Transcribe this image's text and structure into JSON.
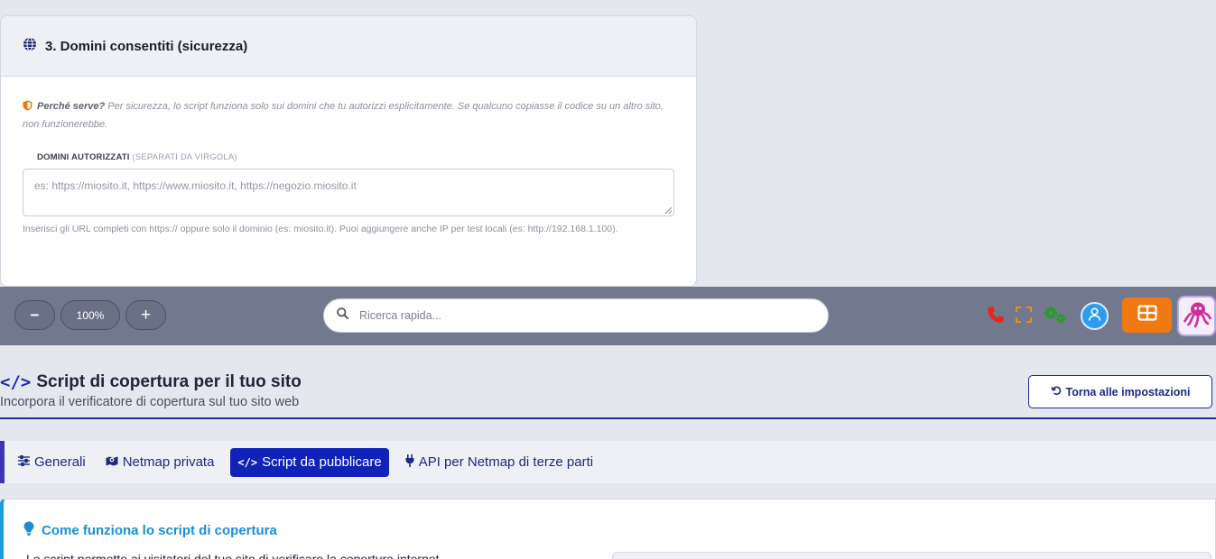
{
  "domains_card": {
    "title": "3. Domini consentiti (sicurezza)",
    "why_label": "Perché serve?",
    "why_text": " Per sicurezza, lo script funziona solo sui domini che tu autorizzi esplicitamente. Se qualcuno copiasse il codice su un altro sito, non funzionerebbe.",
    "field_label": "DOMINI AUTORIZZATI",
    "field_label_sub": "(SEPARATI DA VIRGOLA)",
    "field_placeholder": "es: https://miosito.it, https://www.miosito.it, https://negozio.miosito.it",
    "help_text": "Inserisci gli URL completi con https:// oppure solo il dominio (es: miosito.it). Puoi aggiungere anche IP per test locali (es: http://192.168.1.100)."
  },
  "toolbar": {
    "zoom_out": "−",
    "zoom_level": "100%",
    "zoom_in": "+",
    "search_placeholder": "Ricerca rapida...",
    "icons": [
      "phone-icon",
      "fullscreen-icon",
      "gears-icon",
      "user-icon",
      "grid-icon",
      "octopus-mascot-icon"
    ]
  },
  "page": {
    "title": "Script di copertura per il tuo sito",
    "subtitle": "Incorpora il verificatore di copertura sul tuo sito web",
    "back_label": "Torna alle impostazioni"
  },
  "tabs": [
    {
      "label": "Generali",
      "icon": "sliders-icon",
      "active": false
    },
    {
      "label": "Netmap privata",
      "icon": "map-icon",
      "active": false
    },
    {
      "label": "Script da pubblicare",
      "icon": "code-icon",
      "active": true
    },
    {
      "label": "API per Netmap di terze parti",
      "icon": "plug-icon",
      "active": false
    }
  ],
  "info_card": {
    "title": "Come funziona lo script di copertura",
    "text": "Lo script permette ai visitatori del tuo sito di verificare la copertura internet"
  },
  "colors": {
    "accent": "#1022b8",
    "toolbar": "#72798e",
    "orange": "#f07a12",
    "info": "#1a9be0"
  }
}
